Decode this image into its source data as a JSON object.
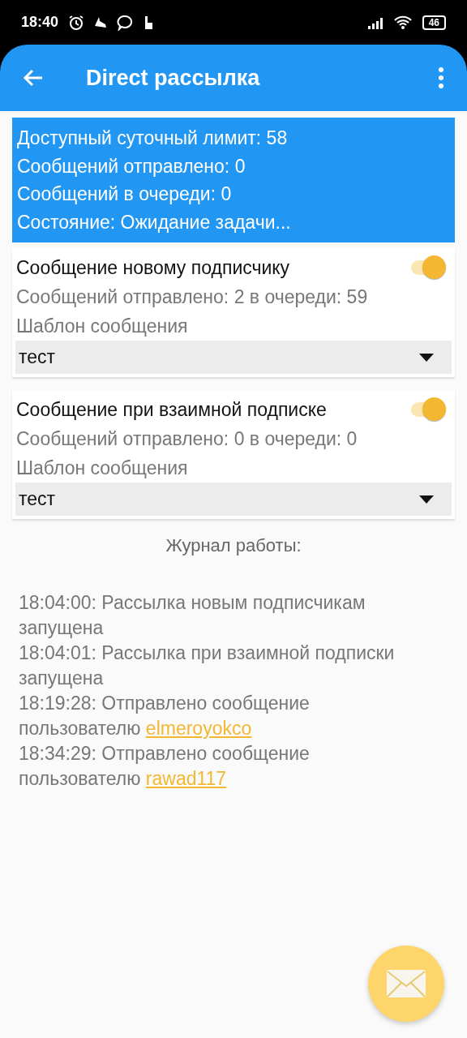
{
  "status_bar": {
    "time": "18:40",
    "battery": "46"
  },
  "app_bar": {
    "title": "Direct рассылка"
  },
  "summary": [
    "Доступный суточный лимит: 58",
    "Сообщений отправлено: 0",
    "Сообщений в очереди: 0",
    "Состояние: Ожидание задачи..."
  ],
  "cards": [
    {
      "title": "Сообщение новому подписчику",
      "on": true,
      "stats": "Сообщений отправлено: 2 в очереди: 59",
      "template_label": "Шаблон сообщения",
      "template_value": "тест"
    },
    {
      "title": "Сообщение при взаимной подписке",
      "on": true,
      "stats": "Сообщений отправлено: 0 в очереди: 0",
      "template_label": "Шаблон сообщения",
      "template_value": "тест"
    }
  ],
  "log": {
    "title": "Журнал работы:",
    "entries": [
      {
        "text": "18:04:00: Рассылка новым подписчикам запущена"
      },
      {
        "text": "18:04:01: Рассылка при взаимной подписки запущена"
      },
      {
        "text": "18:19:28: Отправлено сообщение пользователю",
        "link": "elmeroyokco"
      },
      {
        "text": "18:34:29: Отправлено сообщение пользователю",
        "link": "rawad117"
      }
    ]
  }
}
